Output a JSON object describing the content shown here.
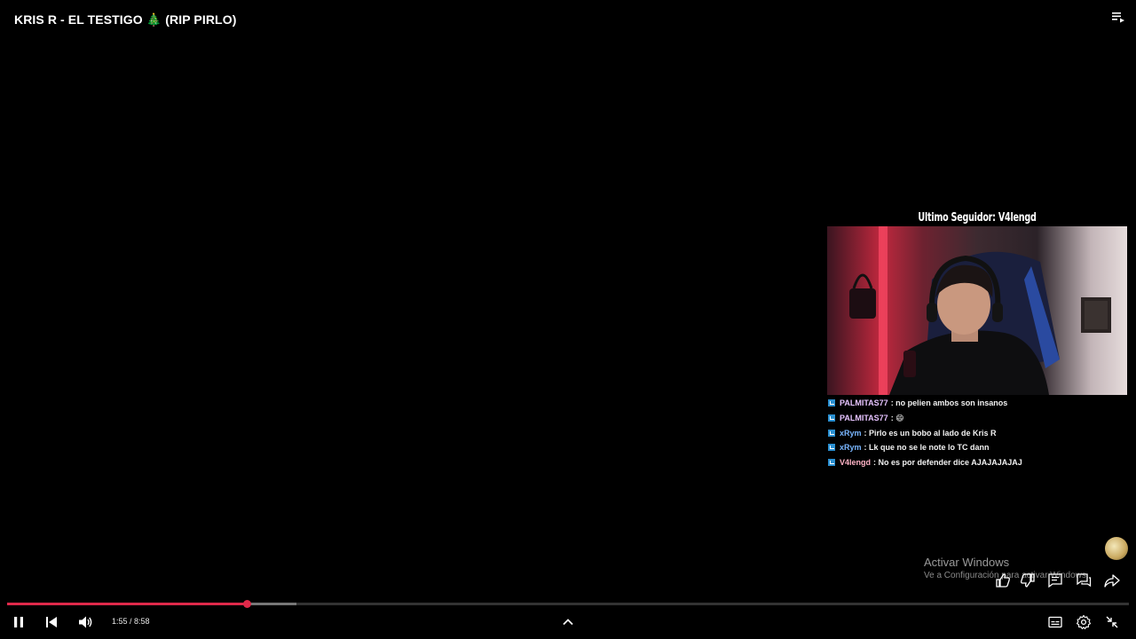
{
  "video": {
    "title": "KRIS R - EL TESTIGO 🎄 (RIP PIRLO)"
  },
  "overlay": {
    "follower_banner": "Ultimo Seguidor: V4lengd",
    "chat": [
      {
        "user": "PALMITAS77",
        "user_color": "#e6c3ff",
        "message": ": no pelien ambos son insanos"
      },
      {
        "user": "PALMITAS77",
        "user_color": "#e6c3ff",
        "message": ": 😄"
      },
      {
        "user": "xRym",
        "user_color": "#79b6ff",
        "message": ": Pirlo es un bobo al lado de Kris R"
      },
      {
        "user": "xRym",
        "user_color": "#79b6ff",
        "message": ": Lk que no se le note lo TC dann"
      },
      {
        "user": "V4lengd",
        "user_color": "#ffb3c6",
        "message": ": No es por defender dice AJAJAJAJAJ"
      }
    ]
  },
  "watermark": {
    "title": "Activar Windows",
    "subtitle": "Ve a Configuración para activar Windows."
  },
  "player": {
    "current_time": "1:55",
    "duration": "8:58",
    "time_display": "1:55 / 8:58",
    "progress_fraction": 0.2138,
    "buffered_fraction": 0.258,
    "accent_color": "#e0294a"
  },
  "icons": {
    "playlist": "playlist-icon",
    "like": "thumb-up-icon",
    "dislike": "thumb-down-icon",
    "comments": "comment-icon",
    "live_chat": "chat-icon",
    "share": "share-icon",
    "pause": "pause-icon",
    "previous": "previous-icon",
    "volume": "volume-icon",
    "expand": "chevron-up-icon",
    "captions": "captions-icon",
    "settings": "gear-icon",
    "exit_fullscreen": "exit-fullscreen-icon"
  }
}
